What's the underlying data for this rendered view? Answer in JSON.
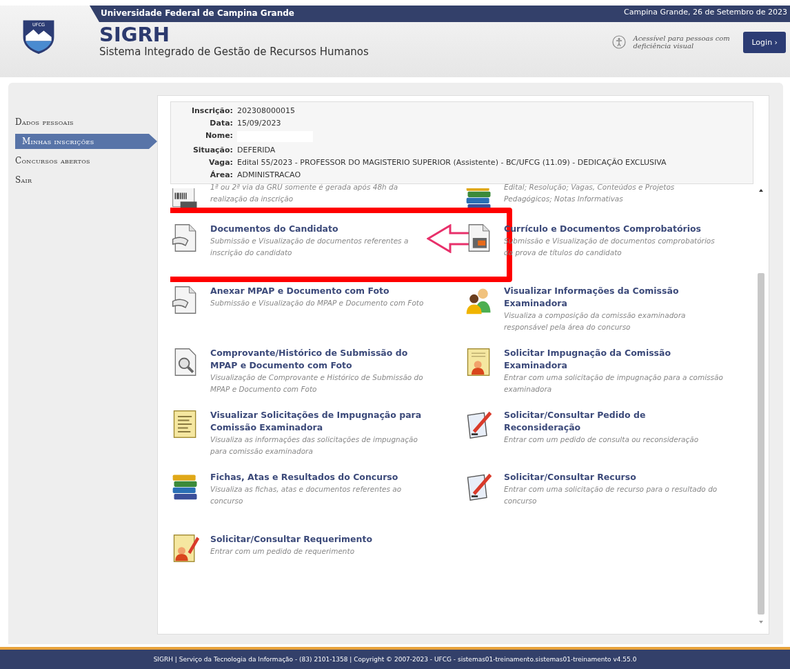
{
  "header": {
    "institution": "Universidade Federal de Campina Grande",
    "date": "Campina Grande, 26 de Setembro de 2023",
    "logo_text": "UFCG",
    "system": "SIGRH",
    "system_full": "Sistema Integrado de Gestão de Recursos Humanos",
    "accessibility": "Acessível para pessoas com deficiência visual",
    "login": "Login ›"
  },
  "sidebar": {
    "items": [
      {
        "label": "Dados pessoais",
        "selected": false
      },
      {
        "label": "Minhas inscrições",
        "selected": true
      },
      {
        "label": "Concursos abertos",
        "selected": false
      },
      {
        "label": "Sair",
        "selected": false
      }
    ]
  },
  "registration": {
    "fields": [
      {
        "label": "Inscrição:",
        "value": "202308000015"
      },
      {
        "label": "Data:",
        "value": "15/09/2023"
      },
      {
        "label": "Nome:",
        "kind": "redacted"
      },
      {
        "label": "Situação:",
        "value": "DEFERIDA"
      },
      {
        "label": "Vaga:",
        "value": "Edital 55/2023 - PROFESSOR DO MAGISTERIO SUPERIOR (Assistente) - BC/UFCG (11.09) - DEDICAÇÃO EXCLUSIVA"
      },
      {
        "label": "Área:",
        "value": "ADMINISTRACAO"
      }
    ]
  },
  "partial_items": [
    {
      "kind": "barcode",
      "description": "1ª ou 2ª via da GRU somente é gerada após 48h da realização da inscrição"
    },
    {
      "kind": "books",
      "description": "Edital; Resolução; Vagas, Conteúdos e Projetos Pedagógicos; Notas Informativas"
    }
  ],
  "items": [
    {
      "kind": "document-pen",
      "title": "Documentos do Candidato",
      "description": "Submissão e Visualização de documentos referentes a inscrição do candidato",
      "highlighted": true
    },
    {
      "kind": "document-photo",
      "title": "Currículo e Documentos Comprobatórios",
      "description": "Submissão e Visualização de documentos comprobatórios da prova de títulos do candidato",
      "highlighted": false
    },
    {
      "kind": "document-pen",
      "title": "Anexar MPAP e Documento com Foto",
      "description": "Submissão e Visualização do MPAP e Documento com Foto",
      "highlighted": false
    },
    {
      "kind": "people",
      "title": "Visualizar Informações da Comissão Examinadora",
      "description": "Visualiza a composição da comissão examinadora responsável pela área do concurso",
      "highlighted": false
    },
    {
      "kind": "magnifier",
      "title": "Comprovante/Histórico de Submissão do MPAP e Documento com Foto",
      "description": "Visualização de Comprovante e Histórico de Submissão do MPAP e Documento com Foto",
      "highlighted": false
    },
    {
      "kind": "certificate",
      "title": "Solicitar Impugnação da Comissão Examinadora",
      "description": "Entrar com uma solicitação de impugnação para a comissão examinadora",
      "highlighted": false
    },
    {
      "kind": "list",
      "title": "Visualizar Solicitações de Impugnação para Comissão Examinadora",
      "description": "Visualiza as informações das solicitações de impugnação para comissão examinadora",
      "highlighted": false
    },
    {
      "kind": "pen-paper",
      "title": "Solicitar/Consultar Pedido de Reconsideração",
      "description": "Entrar com um pedido de consulta ou reconsideração",
      "highlighted": false
    },
    {
      "kind": "books",
      "title": "Fichas, Atas e Resultados do Concurso",
      "description": "Visualiza as fichas, atas e documentos referentes ao concurso",
      "highlighted": false
    },
    {
      "kind": "pen-paper",
      "title": "Solicitar/Consultar Recurso",
      "description": "Entrar com uma solicitação de recurso para o resultado do concurso",
      "highlighted": false
    },
    {
      "kind": "certificate-pen",
      "title": "Solicitar/Consultar Requerimento",
      "description": "Entrar com um pedido de requerimento",
      "highlighted": false
    }
  ],
  "footer": "SIGRH | Serviço da Tecnologia da Informação - (83) 2101-1358 | Copyright © 2007-2023 - UFCG - sistemas01-treinamento.sistemas01-treinamento v4.55.0"
}
